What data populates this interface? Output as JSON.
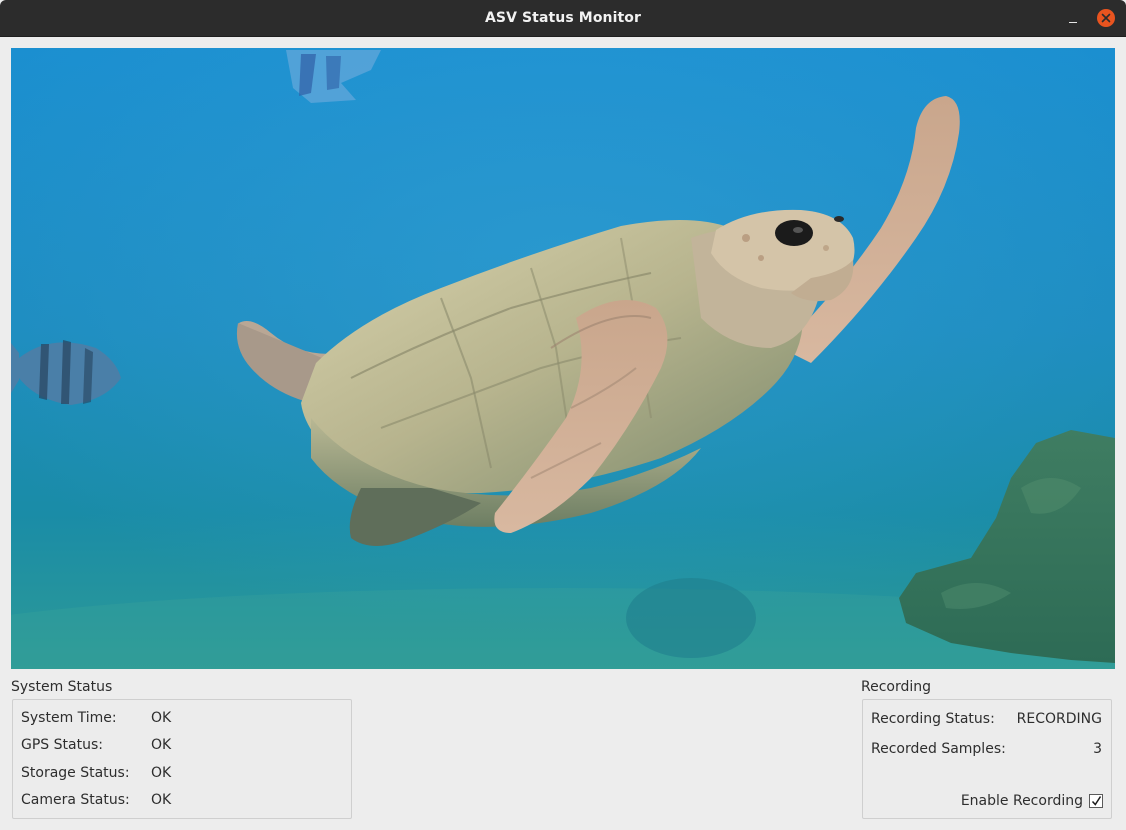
{
  "window": {
    "title": "ASV Status Monitor",
    "minimize_icon": "minimize-icon",
    "close_icon": "close-icon",
    "close_color": "#e9541f"
  },
  "camera": {
    "scene": "sea-turtle-underwater"
  },
  "system_status": {
    "title": "System Status",
    "rows": [
      {
        "label": "System Time:",
        "value": "OK"
      },
      {
        "label": "GPS Status:",
        "value": "OK"
      },
      {
        "label": "Storage Status:",
        "value": "OK"
      },
      {
        "label": "Camera Status:",
        "value": "OK"
      }
    ]
  },
  "recording": {
    "title": "Recording",
    "status_label": "Recording Status:",
    "status_value": "RECORDING",
    "samples_label": "Recorded Samples:",
    "samples_value": "3",
    "enable_label": "Enable Recording",
    "enable_checked": true
  }
}
